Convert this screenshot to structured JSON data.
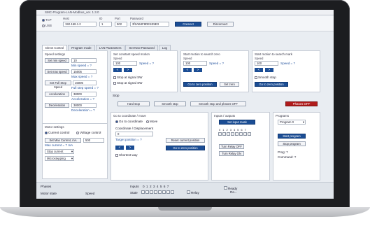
{
  "window": {
    "title": "SMC-Program-LAN-Modbus_ver. 1.3.0"
  },
  "connection": {
    "protocol_tcp": "TCP",
    "protocol_usb": "USB",
    "host_label": "Host",
    "host_value": "192.168.1.2",
    "id_label": "ID",
    "id_value": "1",
    "port_label": "Port",
    "port_value": "502",
    "password_label": "Password",
    "password_value": "3f2AB4F8DE1E5E3",
    "connect": "Connect",
    "disconnect": "Disconnect"
  },
  "tabs": [
    "Direct Control",
    "Program mode",
    "LAN Parameters",
    "Set New Password",
    "Log"
  ],
  "speed_settings": {
    "title": "Speed settings",
    "set_min_speed": "Set min speed",
    "min_value": "10",
    "min_caption": "Min speed = ?",
    "set_max_speed": "Set max speed",
    "max_value": "15005",
    "max_caption": "Max speed = ?",
    "set_full_step_speed": "Set Full Step Speed",
    "full_value": "15005",
    "full_caption": "Full step speed = ?",
    "acceleration_btn": "Acceleration",
    "acc_value": "38000",
    "acc_caption": "Acceleration = ?",
    "deceleration_btn": "Deceleration",
    "dec_value": "38000",
    "dec_caption": "Deceleration = ?"
  },
  "motor_settings": {
    "title": "Motor settings",
    "current_control": "Current control",
    "voltage_control": "Voltage control",
    "set_max_current": "Set Max Current, mA",
    "current_value": "500",
    "current_caption": "Max current = ? mA",
    "stop_current": "Stop current",
    "microstepping": "Microstepping"
  },
  "const_speed": {
    "title": "Set constant speed motion",
    "speed_label": "Speed",
    "speed_value": "100",
    "speed_caption": "Speed = ?",
    "left": "<",
    "right": ">",
    "stop_sw1": "Stop at signal SW",
    "stop_sw2": "Stop at signal SW"
  },
  "search_zero": {
    "title": "Start motion to search zero",
    "speed_label": "Speed",
    "speed_value": "100",
    "speed_caption": "Speed = ?",
    "left": "<",
    "right": ">",
    "goto_zero": "Go to zero position",
    "set_zero": "Set zero"
  },
  "search_mark": {
    "title": "Start motion to search mark",
    "speed_label": "Speed",
    "speed_value": "100",
    "speed_caption": "Speed = ?",
    "left": "<",
    "right": ">",
    "smooth_stop": "Smooth stop",
    "goto_zero": "Go to zero position"
  },
  "stop_section": {
    "title": "Stop",
    "hard_stop": "Hard stop",
    "smooth_stop": "Smooth stop",
    "smooth_stop_phases_off": "Smooth stop and phases OFF",
    "phases_off": "Phases OFF"
  },
  "go_coordinate": {
    "title": "Go to coordinate / move",
    "go_to_coordinate": "Go to coordinate",
    "move": "Move",
    "coord_label": "Coordinate / Displacement",
    "coord_value": "0",
    "target_caption": "Target position = ?",
    "reset_current": "Reset current position",
    "goto_zero": "Go to zero position",
    "left": "<",
    "right": ">",
    "shortest_way": "Shortest way"
  },
  "io": {
    "title": "Inputs / outputs",
    "set_input_mask": "Set input mask",
    "inputs_header": [
      "0",
      "1",
      "2",
      "3",
      "4",
      "5",
      "6",
      "7"
    ],
    "relay_off": "Turn Relay OFF",
    "relay_on": "Turn Relay ON"
  },
  "programs": {
    "title": "Programs",
    "selected": "Program 0",
    "start_program": "Start program",
    "stop_program": "Stop program",
    "prog_caption": "Prog: ?",
    "command_caption": "Command: ?"
  },
  "status": {
    "phases": "Phases",
    "motor_state": "Motor state",
    "speed": "Speed",
    "inputs_label": "Inputs",
    "inputs_idx": [
      "0",
      "1",
      "2",
      "3",
      "4",
      "5",
      "6",
      "7"
    ],
    "state_label": "State",
    "relay": "Relay",
    "ready": "Ready",
    "ready_sub": "Re..."
  },
  "colors": {
    "primary": "#1b4d94",
    "danger": "#b01b1b"
  }
}
